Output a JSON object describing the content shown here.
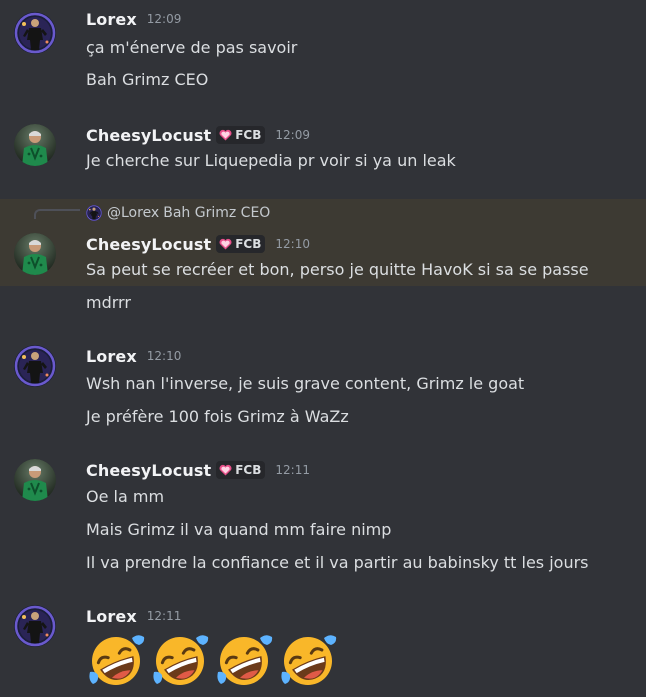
{
  "colors": {
    "background": "#313338",
    "highlight": "#3d3a33",
    "username": "#f2f3f5",
    "timestamp": "#949ba4",
    "text": "#dbdee1"
  },
  "messages": [
    {
      "author": "Lorex",
      "time": "12:09",
      "lines": [
        "ça m'énerve de pas savoir",
        "Bah Grimz CEO"
      ]
    },
    {
      "author": "CheesyLocust",
      "badge": "FCB",
      "time": "12:09",
      "lines": [
        "Je cherche sur Liquepedia pr voir si ya un leak"
      ]
    },
    {
      "reply": {
        "mention": "@Lorex",
        "text": "Bah Grimz CEO"
      },
      "author": "CheesyLocust",
      "badge": "FCB",
      "time": "12:10",
      "lines": [
        "Sa peut se recréer et bon, perso je quitte HavoK si sa se passe",
        "mdrrr"
      ]
    },
    {
      "author": "Lorex",
      "time": "12:10",
      "lines": [
        "Wsh nan l'inverse, je suis grave content, Grimz le goat",
        "Je préfère 100 fois Grimz à WaZz"
      ]
    },
    {
      "author": "CheesyLocust",
      "badge": "FCB",
      "time": "12:11",
      "lines": [
        "Oe la mm",
        "Mais Grimz il va quand mm faire nimp",
        "Il va prendre la confiance et il va partir au babinsky tt les jours"
      ]
    },
    {
      "author": "Lorex",
      "time": "12:11",
      "emojis": [
        "rolling-on-floor-laughing",
        "rolling-on-floor-laughing",
        "rolling-on-floor-laughing",
        "rolling-on-floor-laughing"
      ]
    }
  ]
}
